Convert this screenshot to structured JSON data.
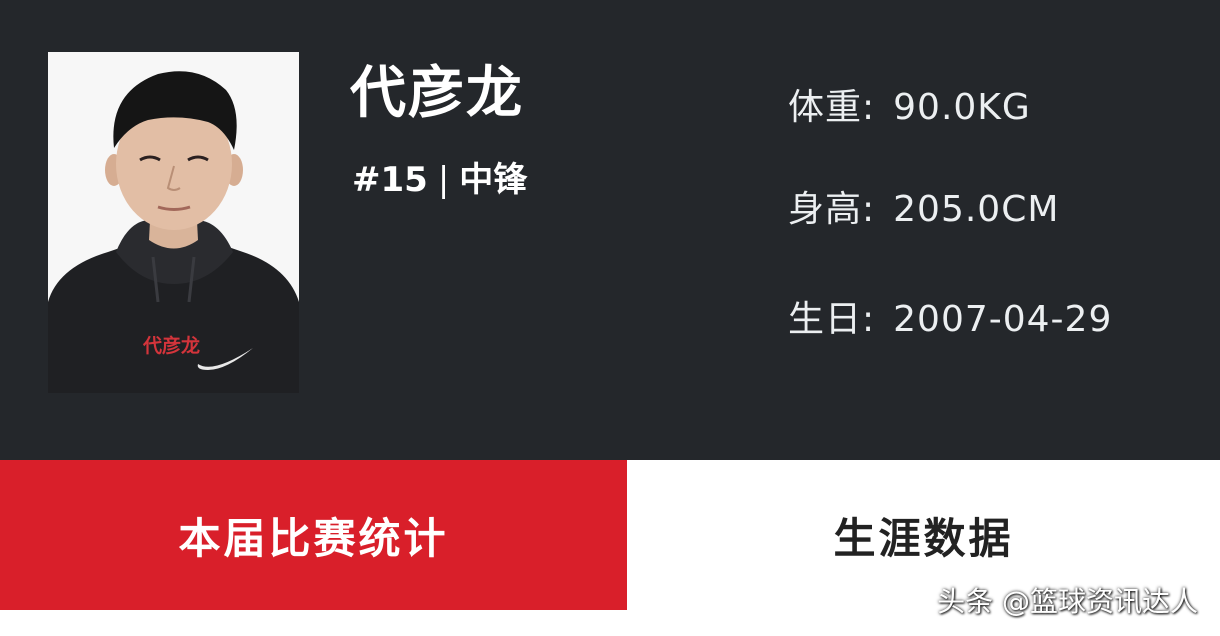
{
  "player": {
    "name": "代彦龙",
    "number": "#15",
    "separator": "|",
    "position": "中锋",
    "photo_shirt_text": "代彦龙"
  },
  "stats": {
    "weight": {
      "label": "体重:",
      "value": "90.0KG"
    },
    "height": {
      "label": "身高:",
      "value": "205.0CM"
    },
    "birthday": {
      "label": "生日:",
      "value": "2007-04-29"
    }
  },
  "tabs": [
    {
      "label": "本届比赛统计",
      "active": true
    },
    {
      "label": "生涯数据",
      "active": false
    }
  ],
  "watermark": "头条 @篮球资讯达人",
  "colors": {
    "panel_bg": "#24272b",
    "active_tab_bg": "#d91f2a",
    "inactive_tab_bg": "#ffffff",
    "text_light": "#ffffff"
  }
}
